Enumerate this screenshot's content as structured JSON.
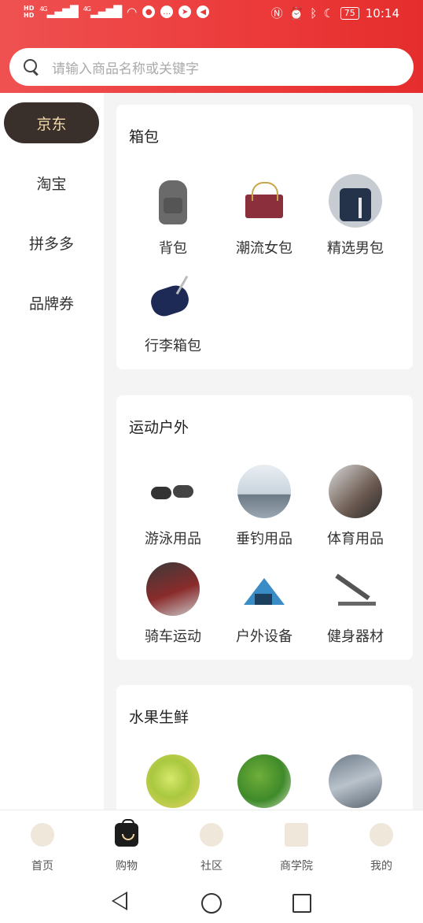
{
  "status_bar": {
    "hd_top": "HD",
    "hd_bottom": "HD",
    "net1": "4G",
    "net2": "4G",
    "battery": "75",
    "time": "10:14",
    "icons": [
      "signal-icon",
      "wifi-icon",
      "nfc-icon",
      "alarm-icon",
      "bluetooth-icon",
      "moon-icon",
      "battery-icon"
    ]
  },
  "search": {
    "placeholder": "请输入商品名称或关键字"
  },
  "sidebar": {
    "items": [
      {
        "label": "京东",
        "active": true
      },
      {
        "label": "淘宝",
        "active": false
      },
      {
        "label": "拼多多",
        "active": false
      },
      {
        "label": "品牌券",
        "active": false
      }
    ]
  },
  "sections": [
    {
      "title": "箱包",
      "items": [
        {
          "label": "背包",
          "icon": "backpack-icon"
        },
        {
          "label": "潮流女包",
          "icon": "handbag-icon"
        },
        {
          "label": "精选男包",
          "icon": "mens-bag-icon"
        },
        {
          "label": "行李箱包",
          "icon": "luggage-icon"
        }
      ]
    },
    {
      "title": "运动户外",
      "items": [
        {
          "label": "游泳用品",
          "icon": "swim-goggles-icon"
        },
        {
          "label": "垂钓用品",
          "icon": "fishing-icon"
        },
        {
          "label": "体育用品",
          "icon": "sports-gear-icon"
        },
        {
          "label": "骑车运动",
          "icon": "cycling-icon"
        },
        {
          "label": "户外设备",
          "icon": "tent-icon"
        },
        {
          "label": "健身器材",
          "icon": "gym-equipment-icon"
        }
      ]
    },
    {
      "title": "水果生鲜",
      "items": [
        {
          "label": "",
          "icon": "fruit-drink-icon"
        },
        {
          "label": "",
          "icon": "broccoli-icon"
        },
        {
          "label": "",
          "icon": "seafood-icon"
        }
      ]
    }
  ],
  "bottom_nav": {
    "items": [
      {
        "label": "首页",
        "icon": "home-icon"
      },
      {
        "label": "购物",
        "icon": "shopping-bag-icon",
        "active": true
      },
      {
        "label": "社区",
        "icon": "community-icon"
      },
      {
        "label": "商学院",
        "icon": "book-icon"
      },
      {
        "label": "我的",
        "icon": "profile-icon"
      }
    ]
  },
  "colors": {
    "header_red": "#ec3a3a",
    "sidebar_active_bg": "#3a302b",
    "sidebar_active_text": "#f3d9a9"
  }
}
